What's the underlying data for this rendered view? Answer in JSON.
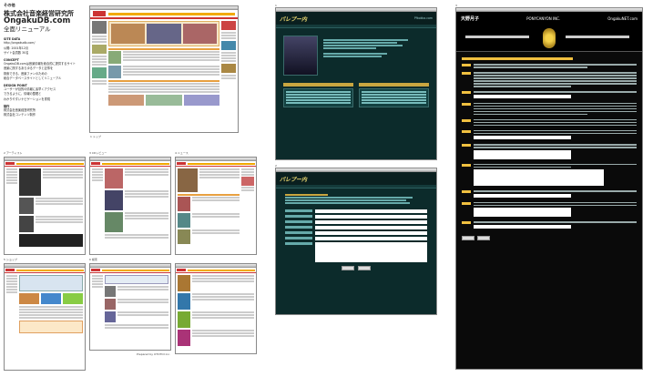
{
  "left": {
    "section": "その他",
    "company": "株式会社音楽経営研究所",
    "site": "OngakuDB.com",
    "renewal": "全面リニューアル",
    "site_data_label": "SITE DATA",
    "site_data_lines": [
      "http://ongakudb.com/",
      "公開: 2001年12月",
      "サイト会員数 30名"
    ],
    "concept_label": "CONCEPT",
    "concept_lines": [
      "OngakuDB.comは音楽情報を総合的に提供するサイト",
      "音楽に関するあらゆるデータと記事を",
      "検索できる、音楽ファンのための",
      "総合データベースサイトとしてリニューアル"
    ],
    "design_label": "DESIGN POINT",
    "design_lines": [
      "ユーザーが目的の情報に素早くアクセス",
      "できるように、情報の整理と",
      "わかりやすいナビゲーションを重視"
    ],
    "credit_label": "制作",
    "credit_lines": [
      "株式会社音楽経営研究所",
      "株式会社コンテンツ制作"
    ]
  },
  "captions": {
    "c_top": "1 トップ",
    "c_artist": "2 アーティスト",
    "c_cd": "3 CDレビュー",
    "c_news": "4 ニュース",
    "c_shop": "5 ショップ",
    "c_search": "6 検索",
    "c_prepared": "Prepared by OTOTOI inc.",
    "c_b1": "1",
    "c_b2": "2",
    "c_b3": "3"
  },
  "kokka": {
    "logo": "パレプー内",
    "url": "Pfkokka.com"
  },
  "ques": {
    "logo": "天野月子",
    "brand": "PONYCANYON INC.",
    "channel": "OngakuNET.com"
  }
}
